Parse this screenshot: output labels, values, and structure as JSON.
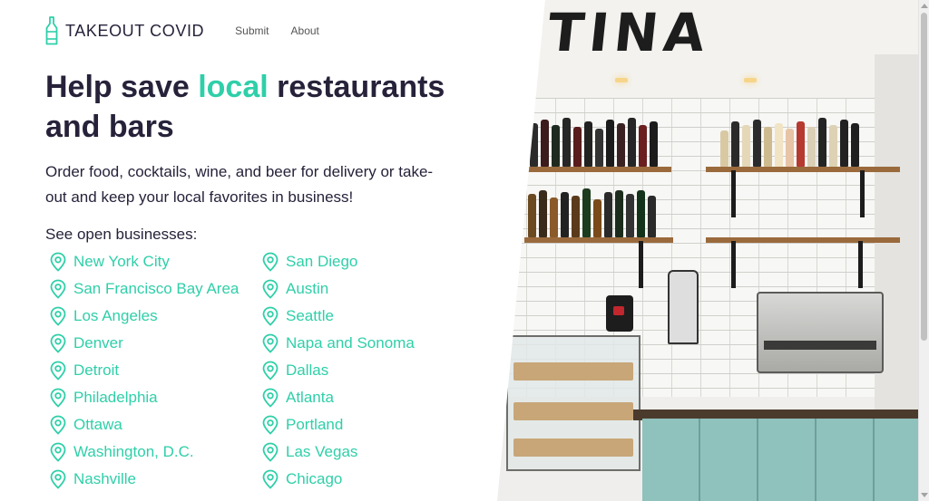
{
  "brand": {
    "name": "TAKEOUT COVID",
    "icon": "bottle-icon",
    "accent_color": "#2fcfa9",
    "text_color": "#27223a"
  },
  "nav": {
    "items": [
      "Submit",
      "About"
    ]
  },
  "hero": {
    "headline_part1": "Help save ",
    "headline_accent": "local",
    "headline_part2": " restaurants and bars",
    "intro": "Order food, cocktails, wine, and beer for delivery or take-out and keep your local favorites in business!"
  },
  "businesses": {
    "title": "See open businesses:",
    "marker_icon": "location-pin-icon",
    "col1": [
      "New York City",
      "San Francisco Bay Area",
      "Los Angeles",
      "Denver",
      "Detroit",
      "Philadelphia",
      "Ottawa",
      "Washington, D.C.",
      "Nashville"
    ],
    "col2": [
      "San Diego",
      "Austin",
      "Seattle",
      "Napa and Sonoma",
      "Dallas",
      "Atlanta",
      "Portland",
      "Las Vegas",
      "Chicago"
    ]
  },
  "photo": {
    "sign_text": "TINA"
  }
}
